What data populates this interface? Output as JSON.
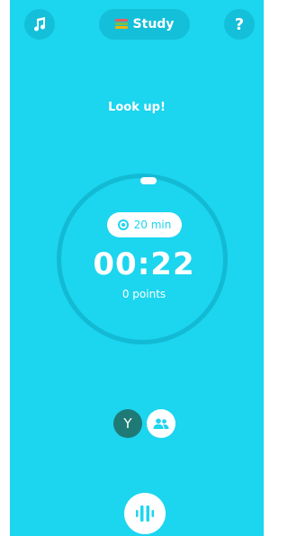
{
  "header": {
    "music_icon": "music-note-icon",
    "mode_label": "Study",
    "mode_icon": "books-icon",
    "help_label": "?"
  },
  "session": {
    "prompt": "Look up!",
    "goal_label": "20 min",
    "goal_icon": "target-icon",
    "timer": "00:22",
    "points": "0 points"
  },
  "participants": {
    "avatar_initial": "Y",
    "friends_icon": "people-icon"
  },
  "controls": {
    "pause_icon": "pause-icon"
  },
  "colors": {
    "background": "#1cd5ef",
    "button_tint": "#14bfd9",
    "ring": "#13bad4",
    "avatar": "#1f7a76",
    "text": "#ffffff"
  }
}
